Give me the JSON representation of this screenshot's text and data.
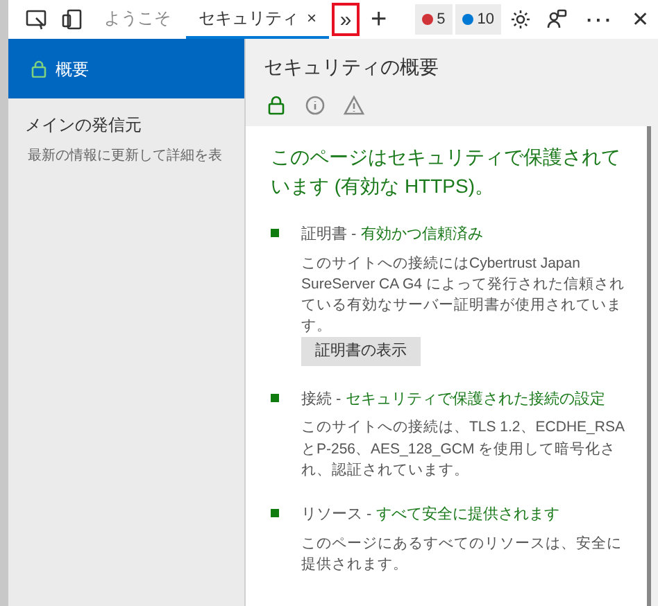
{
  "toolbar": {
    "tabs": [
      {
        "label": "ようこそ",
        "selected": false,
        "closable": false
      },
      {
        "label": "セキュリティ",
        "selected": true,
        "closable": true
      }
    ],
    "close_tab": "×",
    "overflow": {
      "label": "»",
      "highlighted": true
    },
    "add": "+",
    "issues": [
      {
        "count": "5",
        "color": "#d13438"
      },
      {
        "count": "10",
        "color": "#0078d4"
      }
    ],
    "more": "···",
    "close": "✕"
  },
  "sidebar": {
    "items": [
      {
        "label": "概要",
        "selected": true
      }
    ],
    "section_title": "メインの発信元",
    "hint": "最新の情報に更新して詳細を表"
  },
  "main": {
    "title": "セキュリティの概要",
    "filters": [
      {
        "kind": "lock",
        "selected": true
      },
      {
        "kind": "info",
        "selected": false
      },
      {
        "kind": "warning",
        "selected": false
      }
    ],
    "summary": "このページはセキュリティで保護されています (有効な HTTPS)。",
    "sections": [
      {
        "label": "証明書 - ",
        "status": "有効かつ信頼済み",
        "description": "このサイトへの接続にはCybertrust Japan SureServer CA G4 によって発行された信頼されている有効なサーバー証明書が使用されています。",
        "button": "証明書の表示"
      },
      {
        "label": "接続 - ",
        "status": "セキュリティで保護された接続の設定",
        "description": "このサイトへの接続は、TLS 1.2、ECDHE_RSA とP-256、AES_128_GCM を使用して暗号化され、認証されています。"
      },
      {
        "label": "リソース - ",
        "status": "すべて安全に提供されます",
        "description": "このページにあるすべてのリソースは、安全に提供されます。"
      }
    ]
  }
}
